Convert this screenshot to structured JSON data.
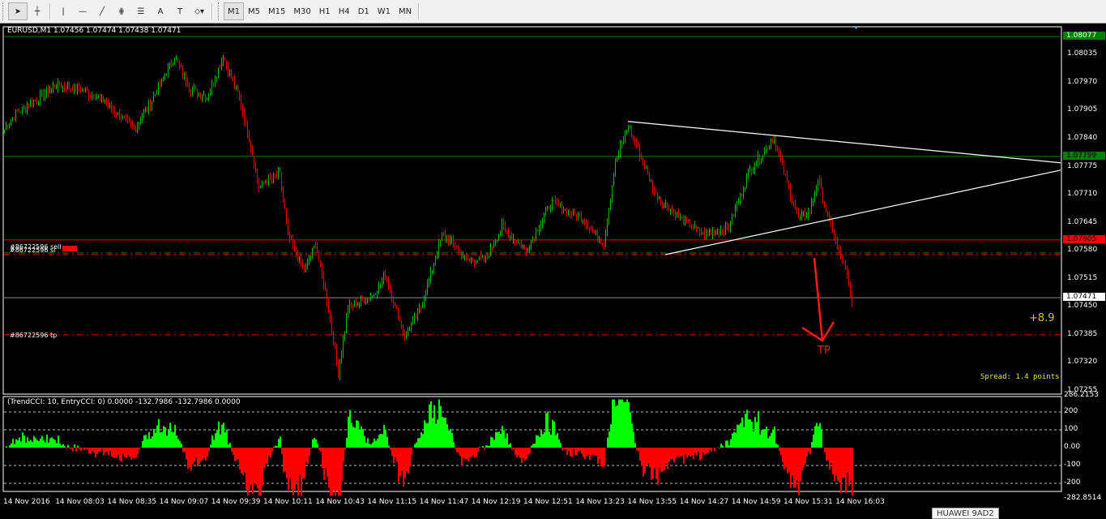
{
  "toolbar": {
    "tools": [
      {
        "name": "cursor",
        "glyph": "➤"
      },
      {
        "name": "crosshair",
        "glyph": "┼"
      },
      {
        "name": "vertical-line",
        "glyph": "|"
      },
      {
        "name": "horizontal-line",
        "glyph": "—"
      },
      {
        "name": "trendline",
        "glyph": "╱"
      },
      {
        "name": "fibonacci-expansion",
        "glyph": "⋕"
      },
      {
        "name": "fibonacci-fan",
        "glyph": "☰"
      },
      {
        "name": "text",
        "glyph": "A"
      },
      {
        "name": "text-label",
        "glyph": "T"
      },
      {
        "name": "arrows",
        "glyph": "⬦▾"
      }
    ],
    "timeframes": [
      "M1",
      "M5",
      "M15",
      "M30",
      "H1",
      "H4",
      "D1",
      "W1",
      "MN"
    ],
    "active_timeframe": "M1"
  },
  "chart_header": "EURUSD,M1  1.07456 1.07474 1.07438 1.07471",
  "price_axis": {
    "labels": [
      "1.08035",
      "1.07970",
      "1.07905",
      "1.07840",
      "1.07775",
      "1.07710",
      "1.07645",
      "1.07580",
      "1.07515",
      "1.07450",
      "1.07385",
      "1.07320",
      "1.07255"
    ],
    "range": [
      1.07255,
      1.08077
    ],
    "markers": [
      {
        "text": "1.08077",
        "value": 1.08077,
        "bg": "#008000",
        "fg": "#ffffff"
      },
      {
        "text": "1.07799",
        "value": 1.07799,
        "bg": "#008000",
        "fg": "#000000"
      },
      {
        "text": "1.07605",
        "value": 1.07605,
        "bg": "#ff0000",
        "fg": "#000000"
      },
      {
        "text": "1.07471",
        "value": 1.07471,
        "bg": "#ffffff",
        "fg": "#000000"
      }
    ]
  },
  "orders": {
    "sell_label": "#86722596 sell",
    "sl_label": "#86722596 sl",
    "tp_label": "#86722596 tp",
    "sell_price": 1.07605,
    "sl_price": 1.07575,
    "tp_price": 1.07385
  },
  "annotations": {
    "tp_text": "TP",
    "profit": "+8.9",
    "spread": "Spread: 1.4 points"
  },
  "indicator": {
    "header": "(TrendCCI: 10, EntryCCI: 0)  0.0000 -132.7986 -132.7986 0.0000",
    "axis_labels": [
      "286.2153",
      "200",
      "100",
      "0.00",
      "-100",
      "-200",
      "-282.8514"
    ],
    "range": [
      -282.8514,
      286.2153
    ]
  },
  "time_axis": [
    "14 Nov 2016",
    "14 Nov 08:03",
    "14 Nov 08:35",
    "14 Nov 09:07",
    "14 Nov 09:39",
    "14 Nov 10:11",
    "14 Nov 10:43",
    "14 Nov 11:15",
    "14 Nov 11:47",
    "14 Nov 12:19",
    "14 Nov 12:51",
    "14 Nov 13:23",
    "14 Nov 13:55",
    "14 Nov 14:27",
    "14 Nov 14:59",
    "14 Nov 15:31",
    "14 Nov 16:03"
  ],
  "tooltip": "HUAWEI 9AD2",
  "colors": {
    "bull": "#00c000",
    "bear": "#ff0000",
    "cci_up": "#00ff00",
    "cci_down": "#ff0000",
    "trend": "#ffffff"
  },
  "chart_data": {
    "type": "candlestick",
    "symbol": "EURUSD",
    "timeframe": "M1",
    "close_waypoints": [
      [
        0,
        1.07861
      ],
      [
        7,
        1.07898
      ],
      [
        32,
        1.07964
      ],
      [
        47,
        1.07955
      ],
      [
        62,
        1.07927
      ],
      [
        80,
        1.07861
      ],
      [
        92,
        1.07936
      ],
      [
        105,
        1.0803
      ],
      [
        115,
        1.07955
      ],
      [
        125,
        1.07936
      ],
      [
        135,
        1.0803
      ],
      [
        145,
        1.07936
      ],
      [
        152,
        1.07823
      ],
      [
        157,
        1.07729
      ],
      [
        170,
        1.07757
      ],
      [
        175,
        1.07616
      ],
      [
        185,
        1.07532
      ],
      [
        192,
        1.07597
      ],
      [
        200,
        1.07447
      ],
      [
        206,
        1.07296
      ],
      [
        212,
        1.07447
      ],
      [
        227,
        1.07475
      ],
      [
        235,
        1.07522
      ],
      [
        247,
        1.07381
      ],
      [
        257,
        1.07447
      ],
      [
        270,
        1.07616
      ],
      [
        277,
        1.07597
      ],
      [
        285,
        1.0756
      ],
      [
        297,
        1.0756
      ],
      [
        307,
        1.07635
      ],
      [
        322,
        1.07579
      ],
      [
        337,
        1.07691
      ],
      [
        357,
        1.07654
      ],
      [
        370,
        1.07597
      ],
      [
        377,
        1.07785
      ],
      [
        385,
        1.0787
      ],
      [
        392,
        1.07804
      ],
      [
        402,
        1.0771
      ],
      [
        417,
        1.07654
      ],
      [
        432,
        1.07616
      ],
      [
        447,
        1.07635
      ],
      [
        460,
        1.07767
      ],
      [
        475,
        1.07842
      ],
      [
        482,
        1.07748
      ],
      [
        490,
        1.07654
      ],
      [
        497,
        1.07673
      ],
      [
        502,
        1.07748
      ],
      [
        507,
        1.07673
      ],
      [
        515,
        1.07579
      ],
      [
        520,
        1.07522
      ],
      [
        523,
        1.0745
      ]
    ],
    "trendlines": [
      {
        "from": [
          385,
          1.0788
        ],
        "to": [
          652,
          1.07784
        ]
      },
      {
        "from": [
          408,
          1.07571
        ],
        "to": [
          652,
          1.07767
        ]
      }
    ]
  }
}
